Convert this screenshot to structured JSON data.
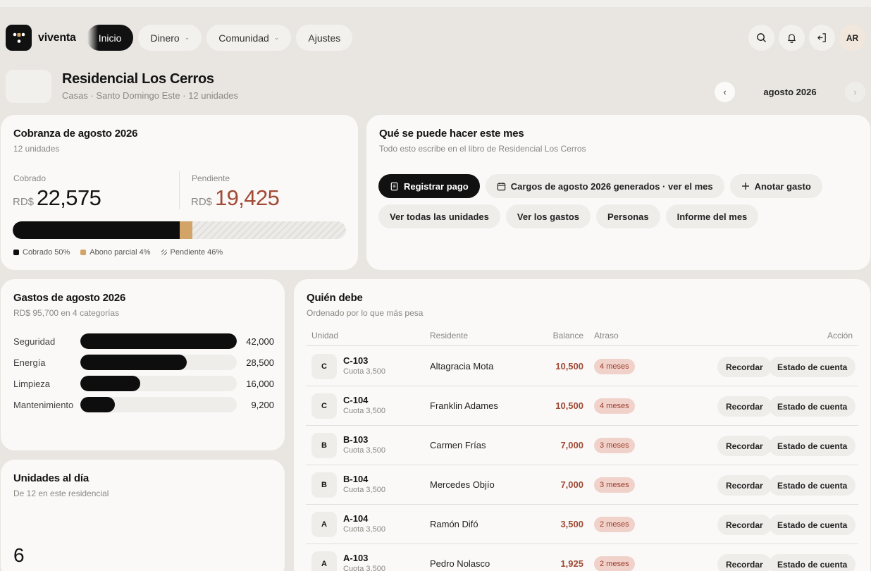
{
  "app": {
    "brand": "viventa"
  },
  "nav": {
    "tabs": [
      {
        "label": "Inicio",
        "active": true
      },
      {
        "label": "Dinero",
        "dropdown": true
      },
      {
        "label": "Comunidad",
        "dropdown": true
      },
      {
        "label": "Ajustes"
      }
    ],
    "avatar_initials": "AR"
  },
  "header": {
    "title": "Residencial Los Cerros",
    "subtitle": "Casas · Santo Domingo Este · 12 unidades",
    "month": "agosto 2026"
  },
  "cobranza": {
    "title": "Cobranza de agosto 2026",
    "subtitle": "12 unidades",
    "cobrado_label": "Cobrado",
    "pendiente_label": "Pendiente",
    "currency": "RD$",
    "cobrado_value": "22,575",
    "pendiente_value": "19,425",
    "progress": {
      "cobrado_pct": 50,
      "abono_pct": 4,
      "pendiente_pct": 46
    },
    "legend": {
      "cobrado": "Cobrado 50%",
      "abono": "Abono parcial 4%",
      "pendiente": "Pendiente 46%"
    },
    "colors": {
      "cobrado": "#0e0e0e",
      "abono": "#d3a468",
      "pendiente_value": "#a14a36"
    }
  },
  "acciones": {
    "title": "Qué se puede hacer este mes",
    "subtitle": "Todo esto escribe en el libro de Residencial Los Cerros",
    "chips": [
      {
        "label": "Registrar pago",
        "icon": "receipt-icon",
        "primary": true
      },
      {
        "label": "Cargos de agosto 2026 generados · ver el mes",
        "icon": "calendar-icon"
      },
      {
        "label": "Anotar gasto",
        "icon": "plus-icon"
      },
      {
        "label": "Ver todas las unidades"
      },
      {
        "label": "Ver los gastos"
      },
      {
        "label": "Personas"
      },
      {
        "label": "Informe del mes"
      }
    ]
  },
  "gastos": {
    "title": "Gastos de agosto 2026",
    "subtitle": "RD$ 95,700 en 4 categorías",
    "max": 42000,
    "items": [
      {
        "name": "Seguridad",
        "value": 42000,
        "label": "42,000"
      },
      {
        "name": "Energía",
        "value": 28500,
        "label": "28,500"
      },
      {
        "name": "Limpieza",
        "value": 16000,
        "label": "16,000"
      },
      {
        "name": "Mantenimiento",
        "value": 9200,
        "label": "9,200"
      }
    ]
  },
  "unidades": {
    "title": "Unidades al día",
    "subtitle": "De 12 en este residencial",
    "value": "6"
  },
  "deudores": {
    "title": "Quién debe",
    "subtitle": "Ordenado por lo que más pesa",
    "columns": {
      "unidad": "Unidad",
      "residente": "Residente",
      "balance": "Balance",
      "atraso": "Atraso",
      "accion": "Acción"
    },
    "rows": [
      {
        "block": "C",
        "unit": "C-103",
        "cuota": "Cuota 3,500",
        "resident": "Altagracia Mota",
        "balance": "10,500",
        "late": "4 meses"
      },
      {
        "block": "C",
        "unit": "C-104",
        "cuota": "Cuota 3,500",
        "resident": "Franklin Adames",
        "balance": "10,500",
        "late": "4 meses"
      },
      {
        "block": "B",
        "unit": "B-103",
        "cuota": "Cuota 3,500",
        "resident": "Carmen Frías",
        "balance": "7,000",
        "late": "3 meses"
      },
      {
        "block": "B",
        "unit": "B-104",
        "cuota": "Cuota 3,500",
        "resident": "Mercedes Objío",
        "balance": "7,000",
        "late": "3 meses"
      },
      {
        "block": "A",
        "unit": "A-104",
        "cuota": "Cuota 3,500",
        "resident": "Ramón Difó",
        "balance": "3,500",
        "late": "2 meses"
      },
      {
        "block": "A",
        "unit": "A-103",
        "cuota": "Cuota 3,500",
        "resident": "Pedro Nolasco",
        "balance": "1,925",
        "late": "2 meses"
      }
    ],
    "remind_label": "Recordar",
    "statement_label": "Estado de cuenta"
  }
}
